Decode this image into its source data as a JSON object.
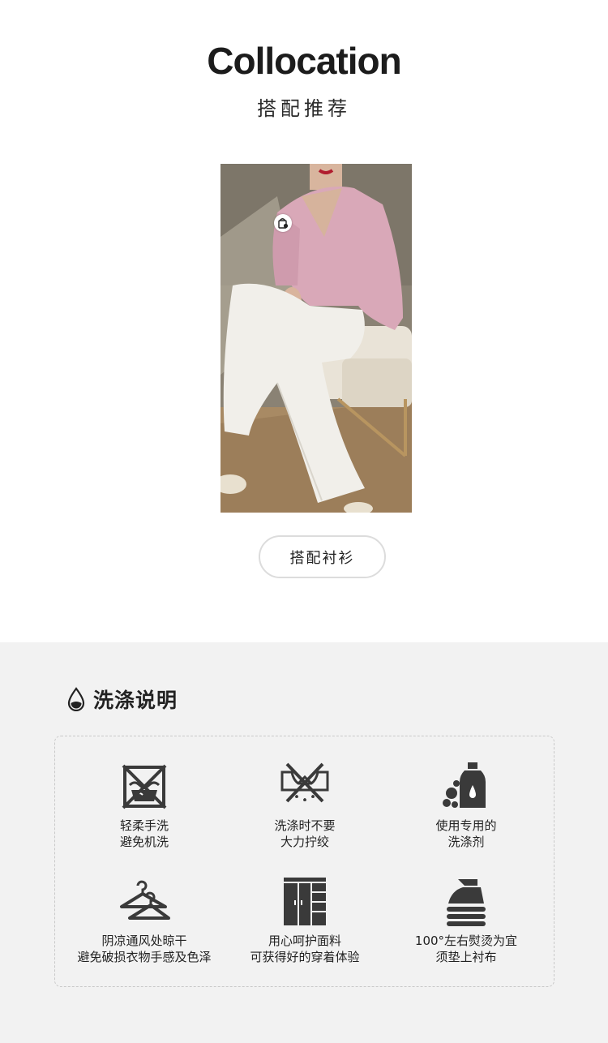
{
  "header": {
    "title_en": "Collocation",
    "title_cn": "搭配推荐"
  },
  "look": {
    "button_label": "搭配衬衫"
  },
  "wash": {
    "title": "洗涤说明",
    "items": [
      {
        "icon": "hand-wash-icon",
        "line1": "轻柔手洗",
        "line2": "避免机洗"
      },
      {
        "icon": "no-wring-icon",
        "line1": "洗涤时不要",
        "line2": "大力拧绞"
      },
      {
        "icon": "detergent-icon",
        "line1": "使用专用的",
        "line2": "洗涤剂"
      },
      {
        "icon": "hanger-icon",
        "line1": "阴凉通风处晾干",
        "line2": "避免破损衣物手感及色泽"
      },
      {
        "icon": "wardrobe-icon",
        "line1": "用心呵护面料",
        "line2": "可获得好的穿着体验"
      },
      {
        "icon": "iron-icon",
        "line1": "100°左右熨烫为宜",
        "line2": "须垫上衬布"
      }
    ]
  },
  "colors": {
    "background_top": "#ffffff",
    "background_bottom": "#f2f2f2",
    "icon": "#3a3a3a",
    "blouse": "#d9a8b8",
    "trousers": "#f1efea"
  }
}
